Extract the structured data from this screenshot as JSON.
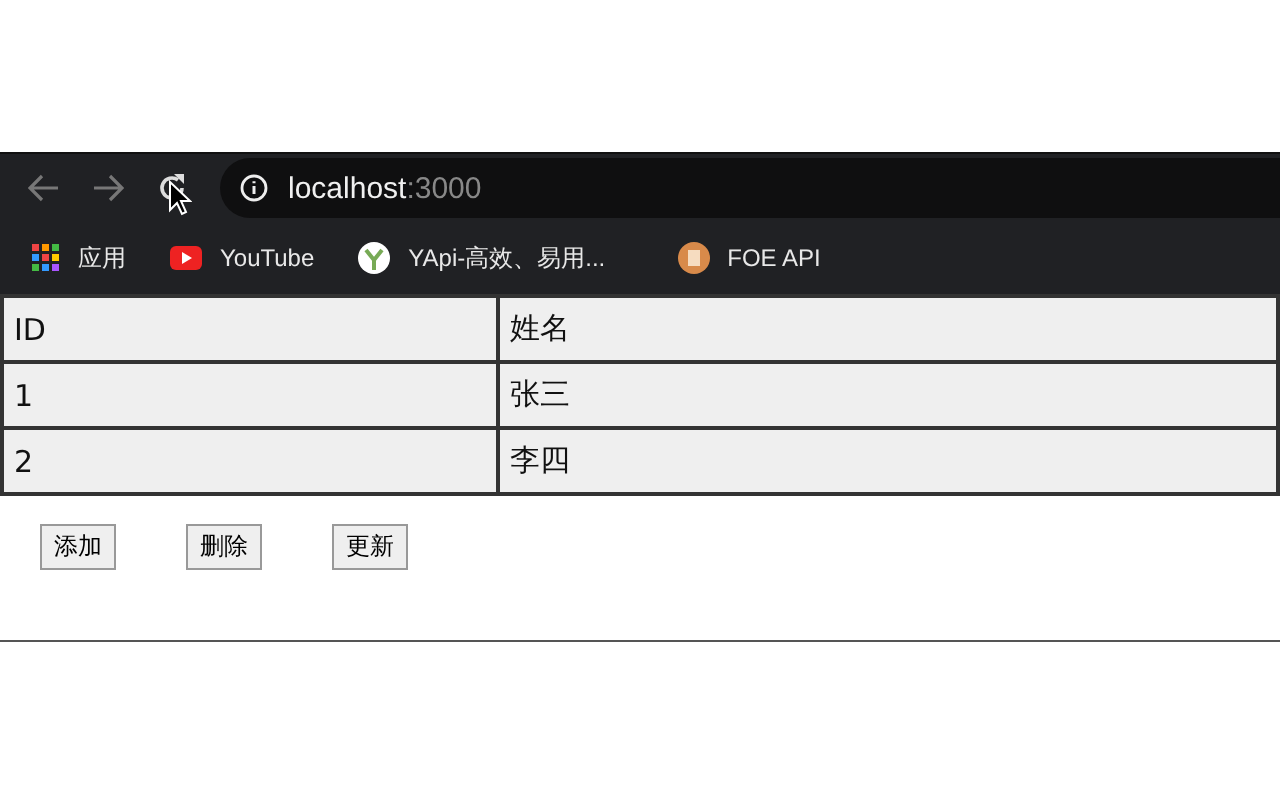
{
  "browser": {
    "url_host": "localhost",
    "url_port": ":3000",
    "bookmarks": [
      {
        "kind": "apps",
        "label": "应用"
      },
      {
        "kind": "youtube",
        "label": "YouTube"
      },
      {
        "kind": "yapi",
        "label": "YApi-高效、易用..."
      },
      {
        "kind": "foe",
        "label": "FOE API"
      }
    ]
  },
  "table": {
    "columns": [
      "ID",
      "姓名"
    ],
    "rows": [
      [
        "1",
        "张三"
      ],
      [
        "2",
        "李四"
      ]
    ]
  },
  "buttons": [
    "添加",
    "删除",
    "更新"
  ]
}
